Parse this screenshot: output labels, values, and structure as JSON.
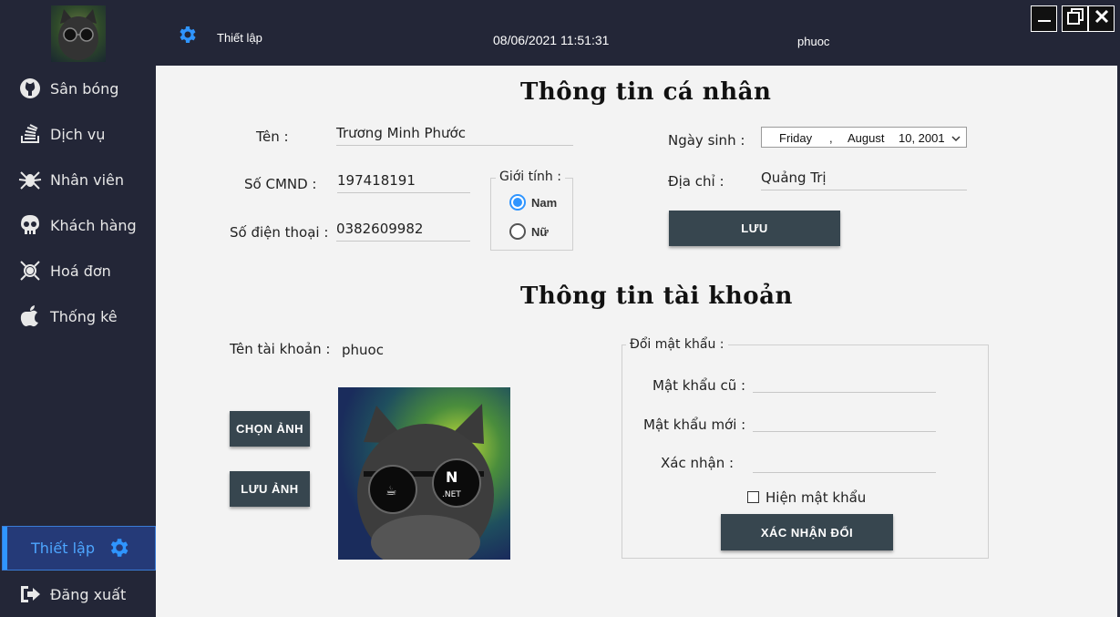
{
  "sidebar": {
    "items": [
      {
        "label": "Sân bóng",
        "icon": "github-icon"
      },
      {
        "label": "Dịch vụ",
        "icon": "stack-icon"
      },
      {
        "label": "Nhân viên",
        "icon": "spider-icon"
      },
      {
        "label": "Khách hàng",
        "icon": "skull-icon"
      },
      {
        "label": "Hoá đơn",
        "icon": "bug-icon"
      },
      {
        "label": "Thống kê",
        "icon": "apple-icon"
      }
    ],
    "active_label": "Thiết lập",
    "logout_label": "Đăng xuất"
  },
  "topbar": {
    "setting_label": "Thiết lập",
    "datetime": "08/06/2021 11:51:31",
    "username": "phuoc"
  },
  "personal": {
    "title": "Thông tin cá nhân",
    "name_label": "Tên :",
    "name_value": "Trương Minh Phước",
    "id_label": "Số CMND :",
    "id_value": "197418191",
    "phone_label": "Số điện thoại :",
    "phone_value": "0382609982",
    "gender_title": "Giới tính :",
    "gender_male": "Nam",
    "gender_female": "Nữ",
    "gender_selected": "Nam",
    "birth_label": "Ngày sinh :",
    "birth_day": "Friday",
    "birth_sep": ",",
    "birth_month": "August",
    "birth_date": "10, 2001",
    "address_label": "Địa chỉ :",
    "address_value": "Quảng Trị",
    "save_button": "LƯU"
  },
  "account": {
    "title": "Thông tin tài khoản",
    "username_label": "Tên tài khoản :",
    "username_value": "phuoc",
    "choose_image_button": "CHỌN ẢNH",
    "save_image_button": "LƯU ẢNH",
    "password_group": "Đổi mật khẩu :",
    "old_password_label": "Mật khẩu cũ :",
    "new_password_label": "Mật khẩu mới :",
    "confirm_label": "Xác nhận :",
    "show_password_label": "Hiện mật khẩu",
    "show_password_checked": false,
    "confirm_button": "XÁC NHẬN ĐỔI"
  },
  "colors": {
    "sidebar_bg": "#232637",
    "main_bg": "#f3f3f3",
    "accent": "#2f95ff",
    "button_bg": "#37464f"
  }
}
